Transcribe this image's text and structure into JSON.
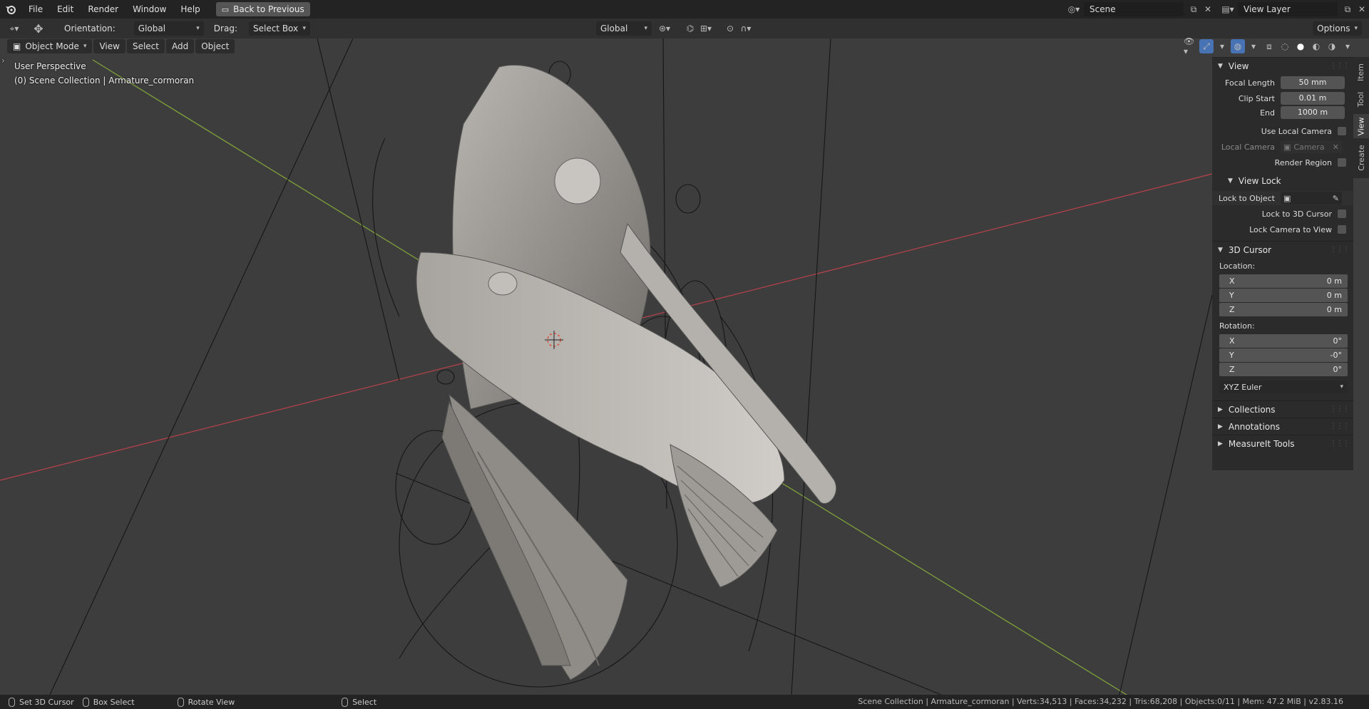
{
  "topbar": {
    "menus": [
      "File",
      "Edit",
      "Render",
      "Window",
      "Help"
    ],
    "back_button": "Back to Previous",
    "scene": "Scene",
    "view_layer": "View Layer"
  },
  "header": {
    "orientation_label": "Orientation:",
    "orientation_value": "Global",
    "drag_label": "Drag:",
    "drag_value": "Select Box",
    "transform_orientation": "Global",
    "options_label": "Options"
  },
  "viewport_header": {
    "mode": "Object Mode",
    "menus": [
      "View",
      "Select",
      "Add",
      "Object"
    ]
  },
  "viewport": {
    "perspective_label": "User Perspective",
    "collection_label": "(0) Scene Collection | Armature_cormoran"
  },
  "npanel": {
    "view_section": "View",
    "focal_length_label": "Focal Length",
    "focal_length_value": "50 mm",
    "clip_start_label": "Clip Start",
    "clip_start_value": "0.01 m",
    "end_label": "End",
    "end_value": "1000 m",
    "use_local_camera": "Use Local Camera",
    "local_camera_label": "Local Camera",
    "local_camera_value": "Camera",
    "render_region": "Render Region",
    "view_lock_section": "View Lock",
    "lock_to_object": "Lock to Object",
    "lock_to_3d_cursor": "Lock to 3D Cursor",
    "lock_camera_to_view": "Lock Camera to View",
    "cursor_section": "3D Cursor",
    "location_label": "Location:",
    "location": [
      {
        "axis": "X",
        "value": "0 m"
      },
      {
        "axis": "Y",
        "value": "0 m"
      },
      {
        "axis": "Z",
        "value": "0 m"
      }
    ],
    "rotation_label": "Rotation:",
    "rotation": [
      {
        "axis": "X",
        "value": "0°"
      },
      {
        "axis": "Y",
        "value": "-0°"
      },
      {
        "axis": "Z",
        "value": "0°"
      }
    ],
    "rotation_mode": "XYZ Euler",
    "collections": "Collections",
    "annotations": "Annotations",
    "measureit": "MeasureIt Tools"
  },
  "vtabs": [
    "Item",
    "Tool",
    "View",
    "Create"
  ],
  "statusbar": {
    "set_cursor": "Set 3D Cursor",
    "box_select": "Box Select",
    "rotate_view": "Rotate View",
    "select": "Select",
    "stats": "Scene Collection | Armature_cormoran | Verts:34,513 | Faces:34,232 | Tris:68,208 | Objects:0/11 | Mem: 47.2 MiB | v2.83.16"
  },
  "colors": {
    "x_axis": "#b8414b",
    "y_axis": "#7fa13a",
    "background": "#3d3d3d",
    "active_blue": "#4772b3"
  }
}
